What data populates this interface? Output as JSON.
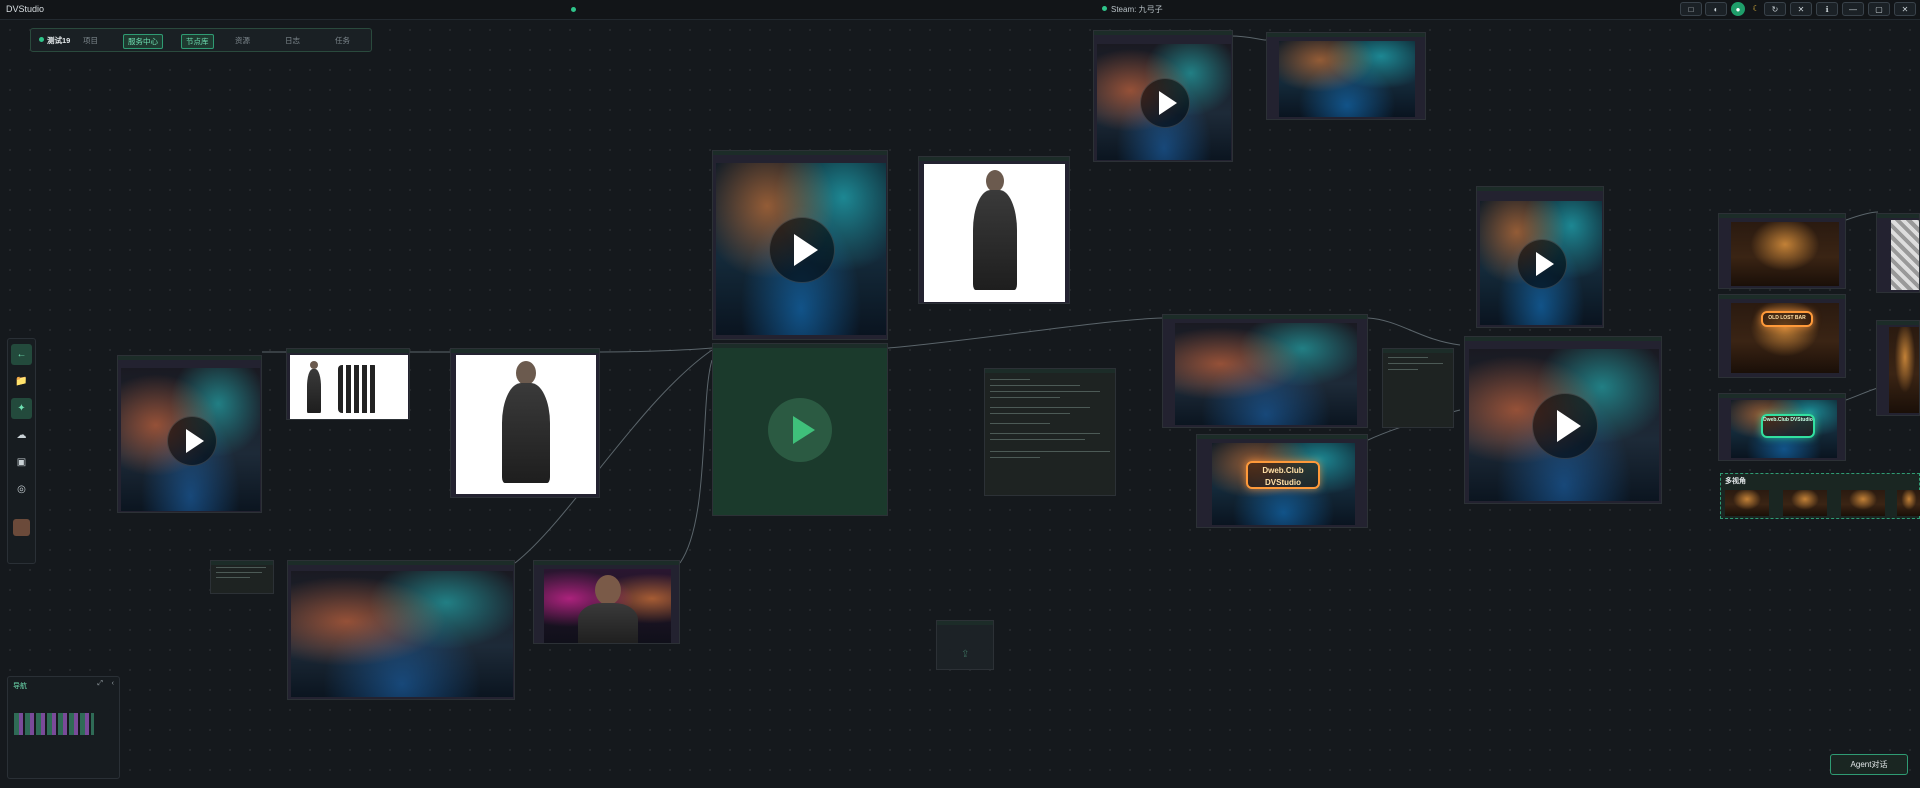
{
  "titlebar": {
    "app_title": "DVStudio",
    "steam_status": "Steam: 九弓子",
    "controls": [
      "□",
      "◐",
      "●",
      "☾",
      "↻",
      "✕",
      "ℹ",
      "—",
      "▢",
      "✕"
    ]
  },
  "toolbar": {
    "project": "测试19",
    "items": [
      "项目",
      "服务中心",
      "节点库",
      "资源",
      "日志",
      "任务"
    ],
    "active": [
      "服务中心",
      "节点库"
    ]
  },
  "sidebar": {
    "buttons": [
      "←",
      "📁",
      "✦",
      "☁",
      "▣",
      "◎",
      "🖼"
    ]
  },
  "nodes": {
    "text_snippets": {
      "small_note": "",
      "code_panel": "",
      "right_panel": ""
    },
    "signs": {
      "dweb": "Dweb.Club DVStudio",
      "bar": "OLD LOST BAR",
      "dweb_small": "Dweb.Club DVStudio"
    },
    "group": {
      "label": "多视角"
    }
  },
  "minimap": {
    "title": "导航"
  },
  "agent_button": {
    "label": "Agent对话"
  },
  "colors": {
    "background": "#15191d",
    "accent": "#2fc48a",
    "node_border": "#2c3136"
  }
}
